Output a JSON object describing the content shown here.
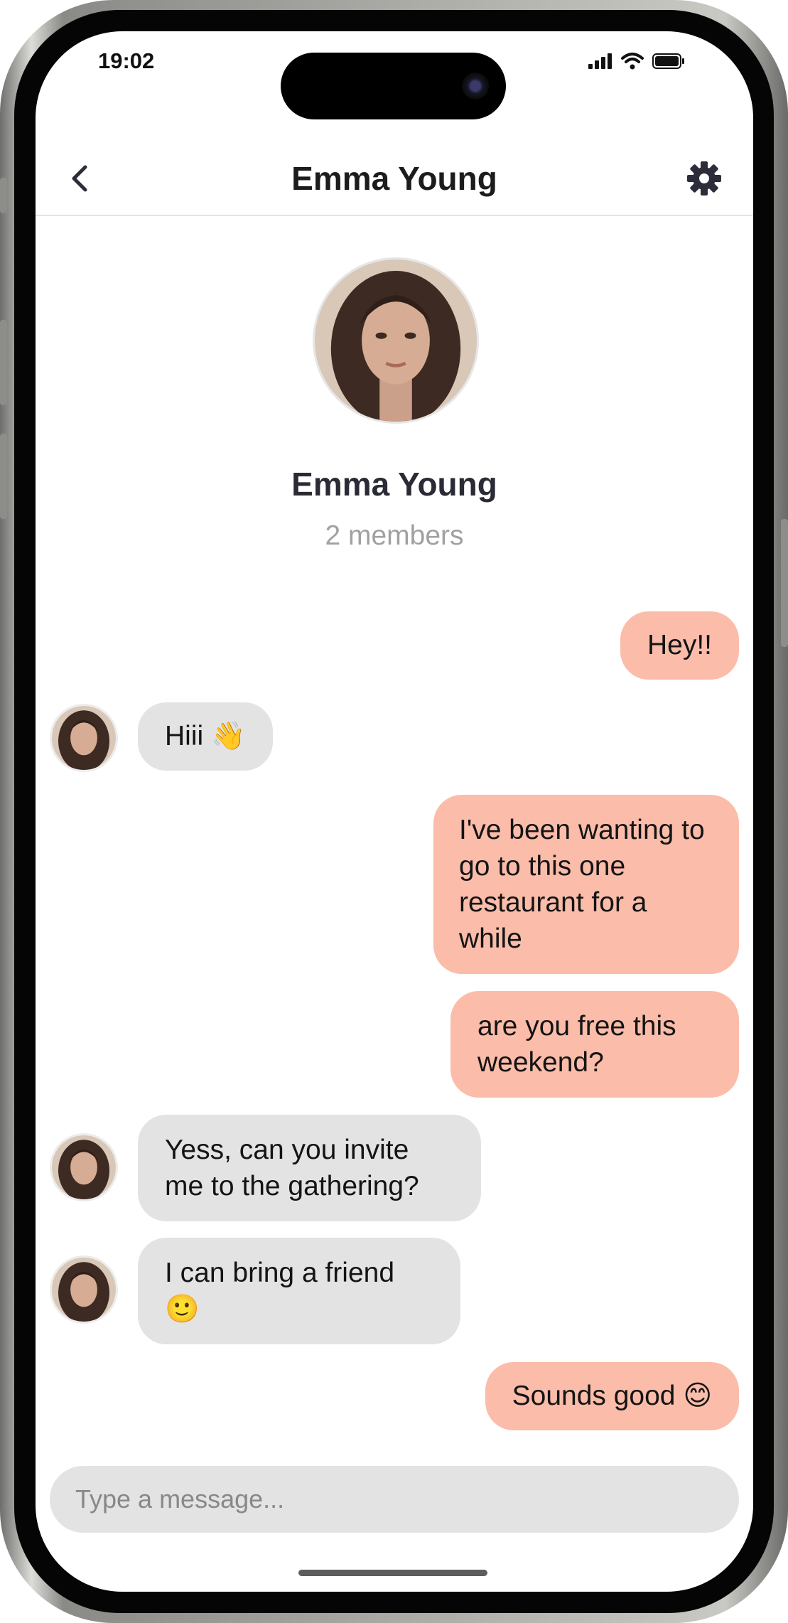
{
  "status_bar": {
    "time": "19:02"
  },
  "header": {
    "title": "Emma Young"
  },
  "profile": {
    "name": "Emma Young",
    "subtitle": "2 members"
  },
  "messages": [
    {
      "from": "me",
      "text": "Hey!!"
    },
    {
      "from": "them",
      "text": "Hiii 👋"
    },
    {
      "from": "me",
      "text": "I've been wanting to go to this one restaurant for a while"
    },
    {
      "from": "me",
      "text": "are you free this weekend?"
    },
    {
      "from": "them",
      "text": "Yess, can you invite me to the gathering?"
    },
    {
      "from": "them",
      "text": "I can bring a friend 🙂"
    },
    {
      "from": "me",
      "text": "Sounds good 😊"
    }
  ],
  "composer": {
    "placeholder": "Type a message..."
  },
  "colors": {
    "outgoing_bubble": "#fbbcaa",
    "incoming_bubble": "#e3e3e3",
    "divider": "#e4e4e4"
  },
  "icons": [
    "back-chevron-icon",
    "gear-icon",
    "signal-icon",
    "wifi-icon",
    "battery-icon",
    "camera-icon"
  ]
}
